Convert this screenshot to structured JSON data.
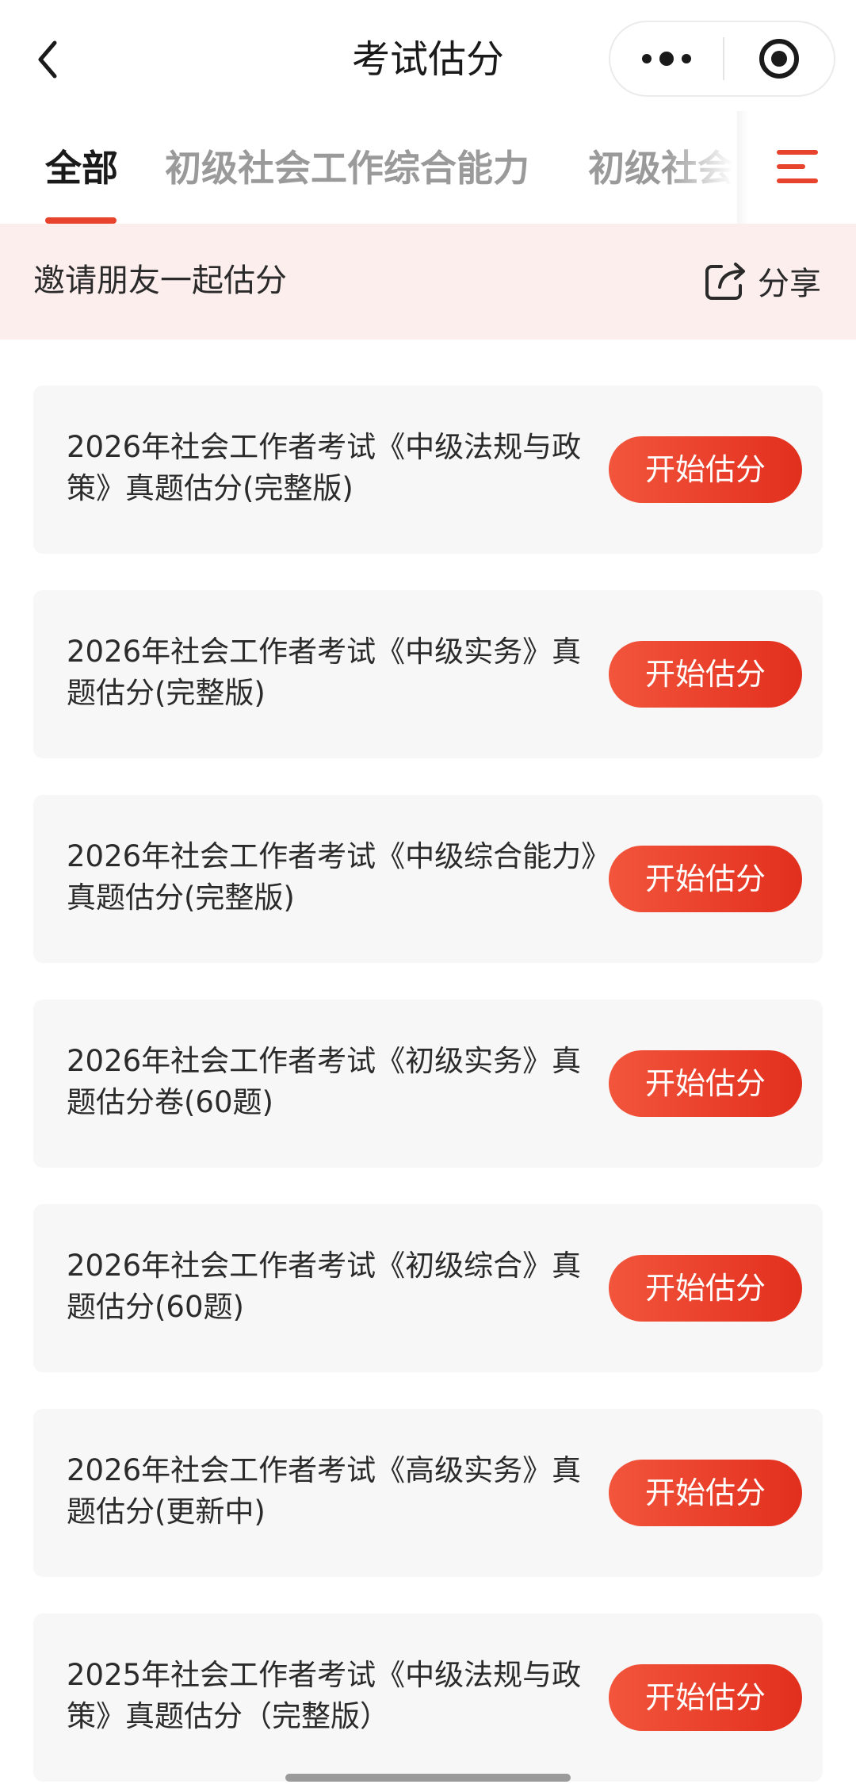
{
  "header": {
    "title": "考试估分",
    "back_icon": "chevron-left-icon",
    "more_icon": "more-dots-icon",
    "close_icon": "target-close-icon"
  },
  "tabs": [
    {
      "label": "全部",
      "active": true
    },
    {
      "label": "初级社会工作综合能力",
      "active": false
    },
    {
      "label": "初级社会",
      "active": false
    }
  ],
  "tabs_menu_icon": "menu-lines-icon",
  "invite": {
    "text": "邀请朋友一起估分",
    "share_label": "分享",
    "share_icon": "share-icon"
  },
  "list": [
    {
      "title": "2026年社会工作者考试《中级法规与政策》真题估分(完整版)",
      "button": "开始估分"
    },
    {
      "title": "2026年社会工作者考试《中级实务》真题估分(完整版)",
      "button": "开始估分"
    },
    {
      "title": "2026年社会工作者考试《中级综合能力》真题估分(完整版)",
      "button": "开始估分"
    },
    {
      "title": "2026年社会工作者考试《初级实务》真题估分卷(60题)",
      "button": "开始估分"
    },
    {
      "title": "2026年社会工作者考试《初级综合》真题估分(60题)",
      "button": "开始估分"
    },
    {
      "title": "2026年社会工作者考试《高级实务》真题估分(更新中)",
      "button": "开始估分"
    },
    {
      "title": "2025年社会工作者考试《中级法规与政策》真题估分（完整版）",
      "button": "开始估分"
    }
  ],
  "colors": {
    "accent": "#e8432c",
    "banner_bg": "#fdeeee",
    "card_bg": "#f7f7f7",
    "tab_inactive": "#9a9a9a"
  }
}
